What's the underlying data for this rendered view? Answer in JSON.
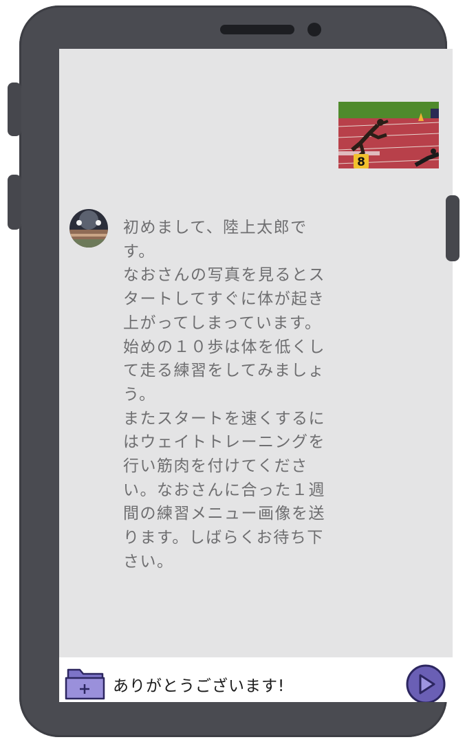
{
  "message": {
    "lines": [
      "初めまして、陸上太郎です。",
      "なおさんの写真を見るとスタートしてすぐに体が起き上がってしまっています。始めの１０歩は体を低くして走る練習をしてみましょう。",
      "またスタートを速くするにはウェイトトレーニングを行い筋肉を付けてください。なおさんに合った１週間の練習メニュー画像を送ります。しばらくお待ち下さい。"
    ]
  },
  "input": {
    "value": "ありがとうございます!"
  },
  "colors": {
    "phone_body": "#4a4b51",
    "screen_bg": "#e4e4e5",
    "message_text": "#6e6e70",
    "send_button": "#6a5fb5",
    "folder_icon": "#8b7fd0"
  },
  "icons": {
    "attach": "folder-plus-icon",
    "send": "send-play-icon"
  }
}
